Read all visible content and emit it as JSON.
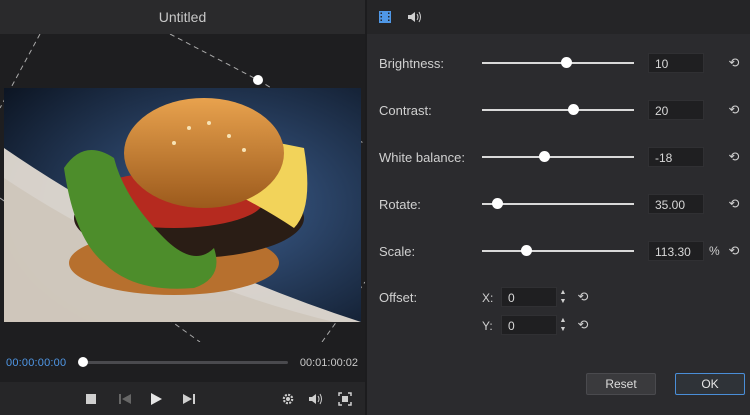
{
  "window": {
    "title": "Untitled"
  },
  "player": {
    "current_time": "00:00:00:00",
    "total_time": "00:01:00:02",
    "progress": 0.0
  },
  "tabs": [
    {
      "name": "video-tab",
      "icon": "film-icon",
      "active": true
    },
    {
      "name": "audio-tab",
      "icon": "speaker-icon",
      "active": false
    }
  ],
  "adjustments": [
    {
      "key": "brightness",
      "label": "Brightness:",
      "value": "10",
      "unit": "",
      "level": 0.55
    },
    {
      "key": "contrast",
      "label": "Contrast:",
      "value": "20",
      "unit": "",
      "level": 0.6
    },
    {
      "key": "white_balance",
      "label": "White balance:",
      "value": "-18",
      "unit": "",
      "level": 0.41
    },
    {
      "key": "rotate",
      "label": "Rotate:",
      "value": "35.00",
      "unit": "",
      "level": 0.1
    },
    {
      "key": "scale",
      "label": "Scale:",
      "value": "113.30",
      "unit": "%",
      "level": 0.29
    }
  ],
  "offset": {
    "label": "Offset:",
    "x_label": "X:",
    "x_value": "0",
    "y_label": "Y:",
    "y_value": "0"
  },
  "buttons": {
    "reset": "Reset",
    "ok": "OK"
  },
  "colors": {
    "accent": "#4f97e6",
    "background": "#2b2b2e"
  }
}
